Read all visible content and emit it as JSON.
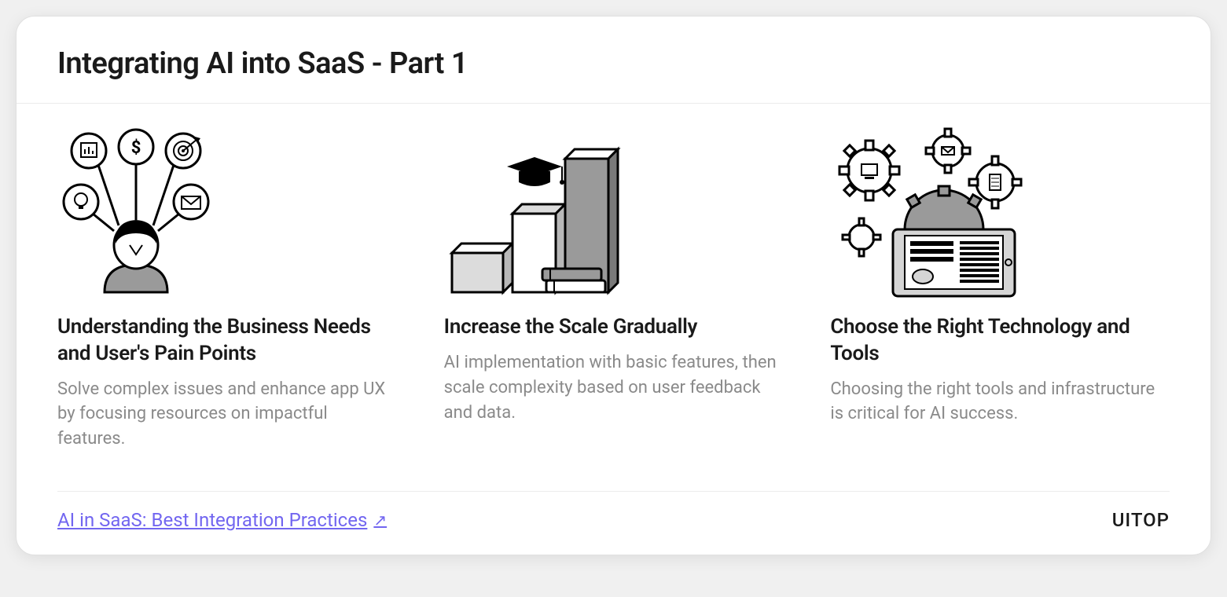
{
  "title": "Integrating AI into SaaS - Part 1",
  "columns": [
    {
      "title": "Understanding the Business Needs and User's Pain Points",
      "desc": "Solve complex issues and enhance app UX by focusing resources on impactful features."
    },
    {
      "title": "Increase the Scale Gradually",
      "desc": "AI implementation with basic features, then scale complexity based on user feedback and data."
    },
    {
      "title": "Choose the Right Technology and Tools",
      "desc": "Choosing the right tools and infrastructure is critical for AI success."
    }
  ],
  "footer": {
    "link_text": "AI in SaaS: Best Integration Practices",
    "brand": "UITOP"
  }
}
